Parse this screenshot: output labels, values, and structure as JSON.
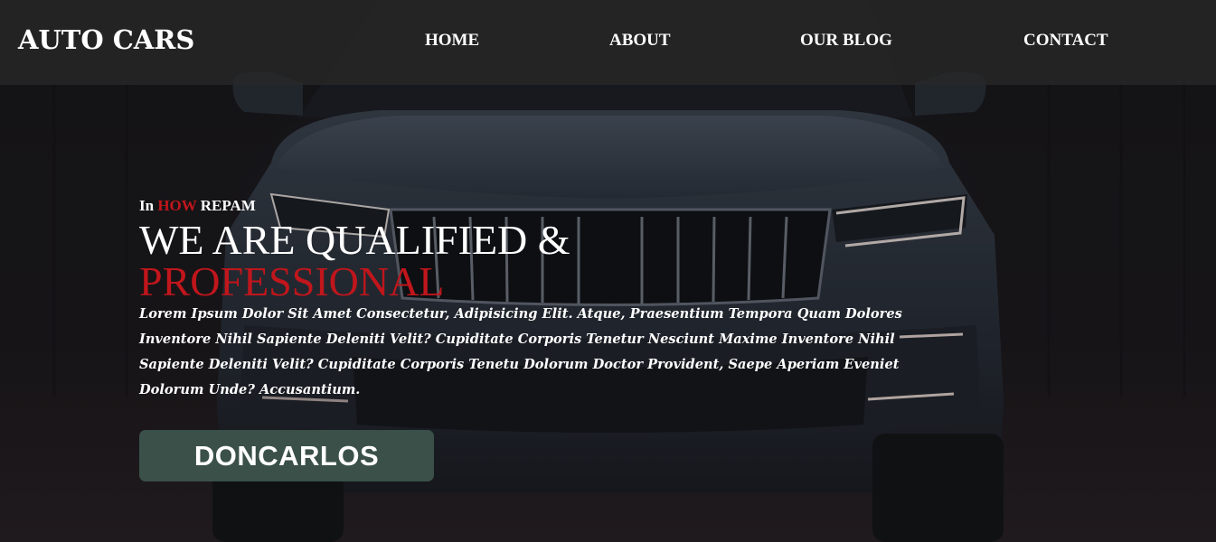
{
  "brand": {
    "name": "AUTO CARS"
  },
  "nav": {
    "items": [
      {
        "label": "HOME"
      },
      {
        "label": "ABOUT"
      },
      {
        "label": "OUR BLOG"
      },
      {
        "label": "CONTACT"
      }
    ]
  },
  "hero": {
    "kicker": {
      "prefix": "In",
      "highlight": "HOW",
      "suffix": "REPAM"
    },
    "headline": {
      "line1": "WE ARE QUALIFIED &",
      "line2": "PROFESSIONAL"
    },
    "lede": "Lorem Ipsum Dolor Sit Amet Consectetur, Adipisicing Elit. Atque, Praesentium Tempora Quam Dolores Inventore Nihil Sapiente Deleniti Velit? Cupiditate Corporis Tenetur Nesciunt Maxime Inventore Nihil Sapiente Deleniti Velit? Cupiditate Corporis Tenetu Dolorum Doctor Provident, Saepe Aperiam Eveniet Dolorum Unde? Accusantium.",
    "cta_label": "DONCARLOS"
  },
  "colors": {
    "accent": "#c0161c",
    "cta_background": "#3a5049",
    "header_background": "#282828"
  }
}
